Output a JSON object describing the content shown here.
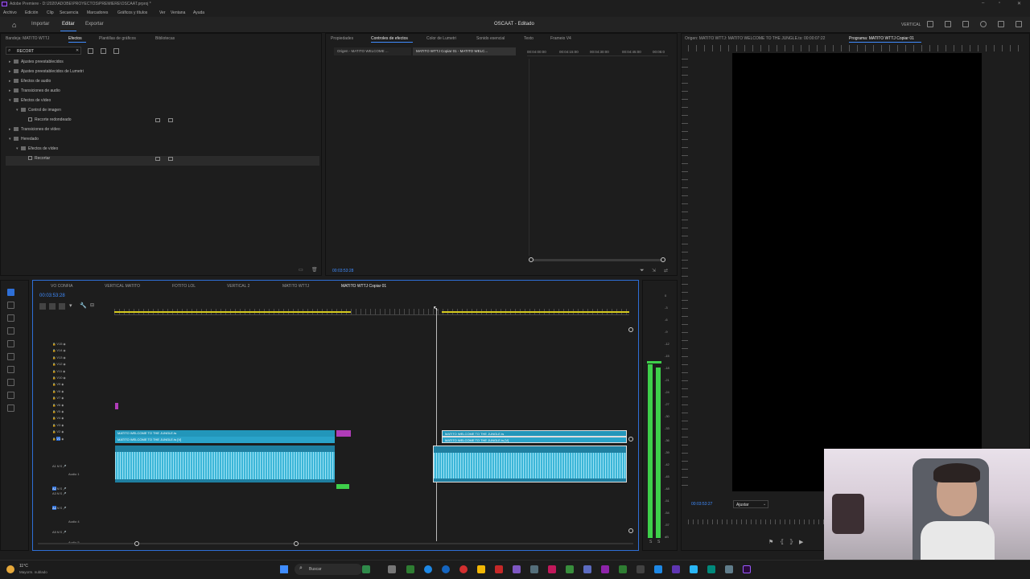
{
  "window": {
    "title": "Adobe Premiere - D:\\2020\\ADOBE\\PROYECTOS\\PREMIERE\\OSCAAT.prproj *"
  },
  "menu": [
    "Archivo",
    "Edición",
    "Clip",
    "Secuencia",
    "Marcadores",
    "Gráficos y títulos",
    "Ver",
    "Ventana",
    "Ayuda"
  ],
  "header": {
    "tabs": [
      "Importar",
      "Editar",
      "Exportar"
    ],
    "project": "OSCAAT - Editado",
    "workspace": "VERTICAL"
  },
  "effects_panel": {
    "tabs": [
      "Bandeja: MATITO WTTJ",
      "Efectos",
      "Plantillas de gráficos",
      "Bibliotecas"
    ],
    "search_value": "RECORT",
    "tree": [
      {
        "label": "Ajustes preestablecidos",
        "indent": 0,
        "open": false
      },
      {
        "label": "Ajustes preestablecidos de Lumetri",
        "indent": 0,
        "open": false
      },
      {
        "label": "Efectos de audio",
        "indent": 0,
        "open": false
      },
      {
        "label": "Transiciones de audio",
        "indent": 0,
        "open": false
      },
      {
        "label": "Efectos de vídeo",
        "indent": 0,
        "open": true
      },
      {
        "label": "Control de imagen",
        "indent": 1,
        "open": true
      },
      {
        "label": "Recorte redondeado",
        "indent": 2,
        "fx": true
      },
      {
        "label": "Transiciones de vídeo",
        "indent": 0,
        "open": false
      },
      {
        "label": "Heredado",
        "indent": 0,
        "open": true
      },
      {
        "label": "Efectos de vídeo",
        "indent": 1,
        "open": true
      },
      {
        "label": "Recortar",
        "indent": 2,
        "fx": true
      }
    ]
  },
  "effect_controls": {
    "tabs": [
      "Propiedades",
      "Controles de efectos",
      "Color de Lumetri",
      "Sonido esencial",
      "Texto",
      "Frameio V4"
    ],
    "subtabs": [
      "Origen - MATITO WELCOME ...",
      "MATITO WTTJ Copiar 01 - MATITO WELC..."
    ],
    "ruler": [
      "00:04:00:00",
      "00:04:15:00",
      "00:04:30:00",
      "00:04:45:00",
      "00:05:0"
    ],
    "timecode": "00:03:53:28"
  },
  "program": {
    "tabs": [
      "Origen: MATITO WTTJ: MATITO WELCOME TO THE JUNGLE.ts: 00:00:07:22",
      "Programa: MATITO WTTJ Copiar 01"
    ],
    "timecode": "00:03:53:27",
    "fit": "Ajustar"
  },
  "timeline": {
    "tabs": [
      "VO CONFIA",
      "VERTICAL MATITO",
      "FOTITO LOL",
      "VERTICAL 2",
      "MATITO WTTJ",
      "MATITO WTTJ Copiar 01"
    ],
    "timecode": "00:03:53:28",
    "video_tracks": [
      "V15",
      "V14",
      "V13",
      "V12",
      "V11",
      "V10",
      "V9",
      "V8",
      "V7",
      "V6",
      "V5",
      "V4",
      "V3",
      "V2",
      "V1"
    ],
    "audio_tracks": [
      "A1",
      "A2",
      "A3",
      "A4",
      "A5"
    ],
    "audio_names": [
      "Audio 1",
      "Audio 4",
      "Audio 5"
    ],
    "clip_v_top": "MATITO WELCOME TO THE JUNGLE.ts",
    "clip_v_main": "MATITO WELCOME TO THE JUNGLE.ts [V]",
    "clip_v_top_right": "MATITO WELCOME TO THE JUNGLE.ts",
    "clip_v_main_right": "MATITO WELCOME TO THE JUNGLE.ts [V]",
    "vu_scale": [
      "0",
      "-3",
      "-6",
      "-9",
      "-12",
      "-15",
      "-18",
      "-21",
      "-24",
      "-27",
      "-30",
      "-33",
      "-36",
      "-39",
      "-42",
      "-45",
      "-48",
      "-51",
      "-54",
      "-57",
      "dB"
    ]
  },
  "taskbar": {
    "search": "Buscar",
    "weather_temp": "11°C",
    "weather_desc": "Mayorm. nublado"
  },
  "colors": {
    "accent": "#3f8cff",
    "clip": "#2aa3c9",
    "audio": "#1f7fa0",
    "vu": "#3ecf4a",
    "pink": "#b03cb8"
  }
}
